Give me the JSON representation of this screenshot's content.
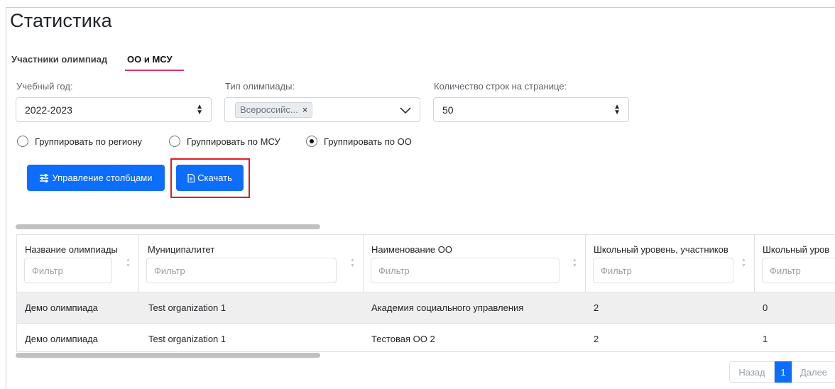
{
  "page": {
    "title": "Статистика"
  },
  "tabs": [
    {
      "label": "Участники олимпиад"
    },
    {
      "label": "ОО и МСУ"
    }
  ],
  "filters": {
    "year": {
      "label": "Учебный год:",
      "value": "2022-2023"
    },
    "olympiad_type": {
      "label": "Тип олимпиады:",
      "chip": "Всероссийс...",
      "chip_remove": "×"
    },
    "rows_per_page": {
      "label": "Количество строк на странице:",
      "value": "50"
    }
  },
  "grouping": {
    "options": [
      {
        "label": "Группировать по региону",
        "selected": false
      },
      {
        "label": "Группировать по МСУ",
        "selected": false
      },
      {
        "label": "Группировать по ОО",
        "selected": true
      }
    ]
  },
  "toolbar": {
    "manage_columns_label": "Управление столбцами",
    "download_label": "Скачать"
  },
  "table": {
    "filter_placeholder": "Фильтр",
    "columns": [
      "Название олимпиады",
      "Муниципалитет",
      "Наименование ОО",
      "Школьный уровень, участников",
      "Школьный уров"
    ],
    "rows": [
      [
        "Демо олимпиада",
        "Test organization 1",
        "Академия социального управления",
        "2",
        "0"
      ],
      [
        "Демо олимпиада",
        "Test organization 1",
        "Тестовая ОО 2",
        "2",
        "1"
      ]
    ]
  },
  "pagination": {
    "prev_label": "Назад",
    "current_page": "1",
    "next_label": "Далее"
  },
  "colors": {
    "primary": "#0d6efd",
    "tab_active_underline": "#d6336c",
    "highlight": "#e01e1e"
  }
}
